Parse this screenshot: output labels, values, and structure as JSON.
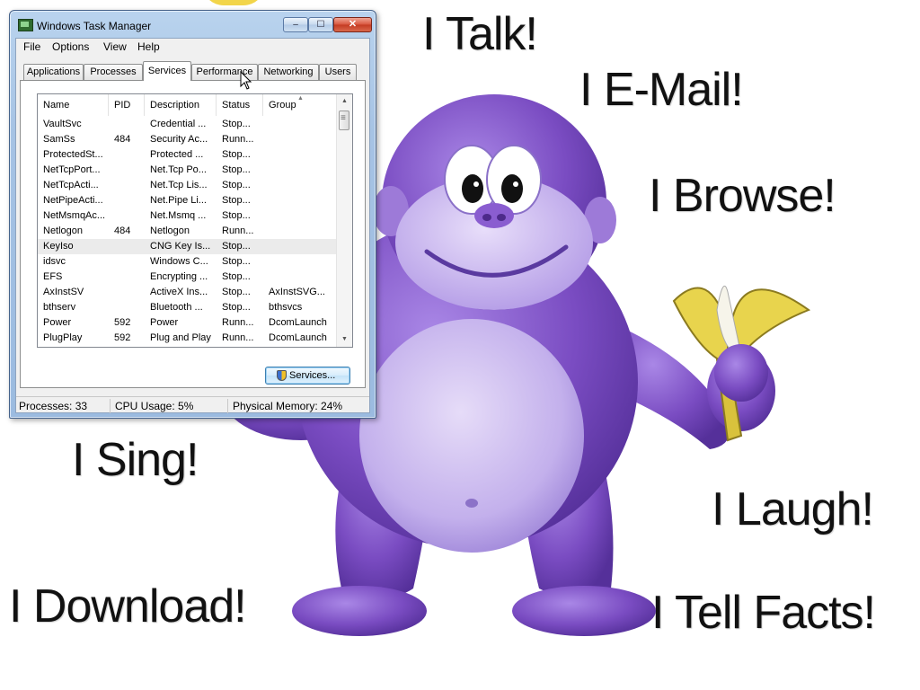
{
  "background": {
    "captions": [
      "I Talk!",
      "I E-Mail!",
      "I Browse!",
      "I Sing!",
      "I Laugh!",
      "I Download!",
      "I Tell Facts!"
    ],
    "character_color": "#7a4cc2",
    "banana_color": "#e8d44d"
  },
  "window": {
    "title": "Windows Task Manager",
    "controls": {
      "minimize": "–",
      "maximize": "☐",
      "close": "✕"
    },
    "menu": [
      "File",
      "Options",
      "View",
      "Help"
    ],
    "tabs": [
      "Applications",
      "Processes",
      "Services",
      "Performance",
      "Networking",
      "Users"
    ],
    "active_tab": "Services",
    "columns": [
      "Name",
      "PID",
      "Description",
      "Status",
      "Group"
    ],
    "rows": [
      {
        "name": "VaultSvc",
        "pid": "",
        "description": "Credential ...",
        "status": "Stop...",
        "group": ""
      },
      {
        "name": "SamSs",
        "pid": "484",
        "description": "Security Ac...",
        "status": "Runn...",
        "group": ""
      },
      {
        "name": "ProtectedSt...",
        "pid": "",
        "description": "Protected ...",
        "status": "Stop...",
        "group": ""
      },
      {
        "name": "NetTcpPort...",
        "pid": "",
        "description": "Net.Tcp Po...",
        "status": "Stop...",
        "group": ""
      },
      {
        "name": "NetTcpActi...",
        "pid": "",
        "description": "Net.Tcp Lis...",
        "status": "Stop...",
        "group": ""
      },
      {
        "name": "NetPipeActi...",
        "pid": "",
        "description": "Net.Pipe Li...",
        "status": "Stop...",
        "group": ""
      },
      {
        "name": "NetMsmqAc...",
        "pid": "",
        "description": "Net.Msmq ...",
        "status": "Stop...",
        "group": ""
      },
      {
        "name": "Netlogon",
        "pid": "484",
        "description": "Netlogon",
        "status": "Runn...",
        "group": ""
      },
      {
        "name": "KeyIso",
        "pid": "",
        "description": "CNG Key Is...",
        "status": "Stop...",
        "group": ""
      },
      {
        "name": "idsvc",
        "pid": "",
        "description": "Windows C...",
        "status": "Stop...",
        "group": ""
      },
      {
        "name": "EFS",
        "pid": "",
        "description": "Encrypting ...",
        "status": "Stop...",
        "group": ""
      },
      {
        "name": "AxInstSV",
        "pid": "",
        "description": "ActiveX Ins...",
        "status": "Stop...",
        "group": "AxInstSVG..."
      },
      {
        "name": "bthserv",
        "pid": "",
        "description": "Bluetooth ...",
        "status": "Stop...",
        "group": "bthsvcs"
      },
      {
        "name": "Power",
        "pid": "592",
        "description": "Power",
        "status": "Runn...",
        "group": "DcomLaunch"
      },
      {
        "name": "PlugPlay",
        "pid": "592",
        "description": "Plug and Play",
        "status": "Runn...",
        "group": "DcomLaunch"
      }
    ],
    "highlighted_row": 8,
    "services_button": "Services...",
    "status": {
      "processes": "Processes: 33",
      "cpu": "CPU Usage: 5%",
      "memory": "Physical Memory: 24%"
    }
  }
}
